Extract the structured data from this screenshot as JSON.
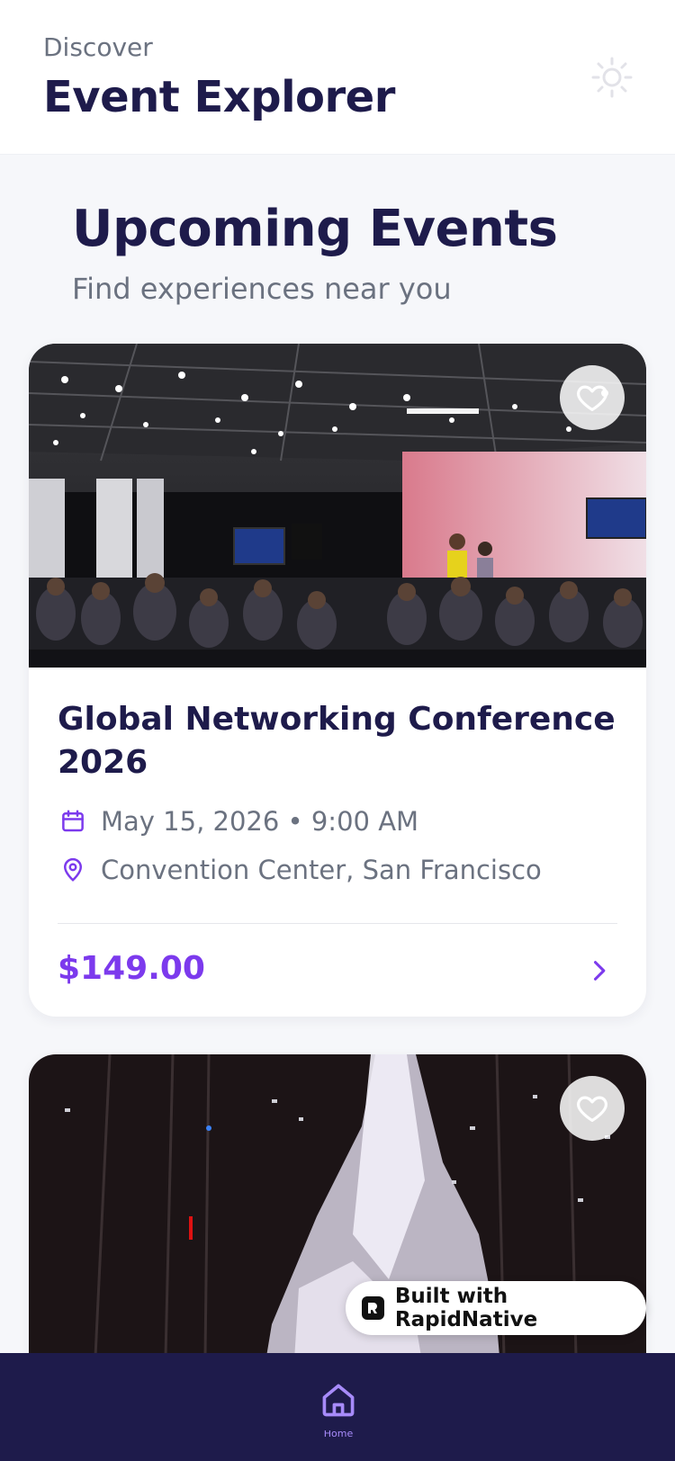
{
  "header": {
    "eyebrow": "Discover",
    "title": "Event Explorer",
    "theme_icon": "sun-icon"
  },
  "section": {
    "title": "Upcoming Events",
    "subtitle": "Find experiences near you"
  },
  "events": [
    {
      "title": "Global Networking Conference 2026",
      "date": "May 15, 2026 • 9:00 AM",
      "location": "Convention Center, San Francisco",
      "price": "$149.00",
      "favorited": false
    },
    {
      "title": "",
      "favorited": false
    }
  ],
  "badge": {
    "label": "Built with RapidNative"
  },
  "tabbar": {
    "items": [
      {
        "icon": "home-icon",
        "label": "Home",
        "active": true
      }
    ]
  },
  "colors": {
    "primary_text": "#1e1b4b",
    "accent": "#7c3aed",
    "tabbar_bg": "#1e1b4b",
    "muted_text": "#6b7280"
  }
}
